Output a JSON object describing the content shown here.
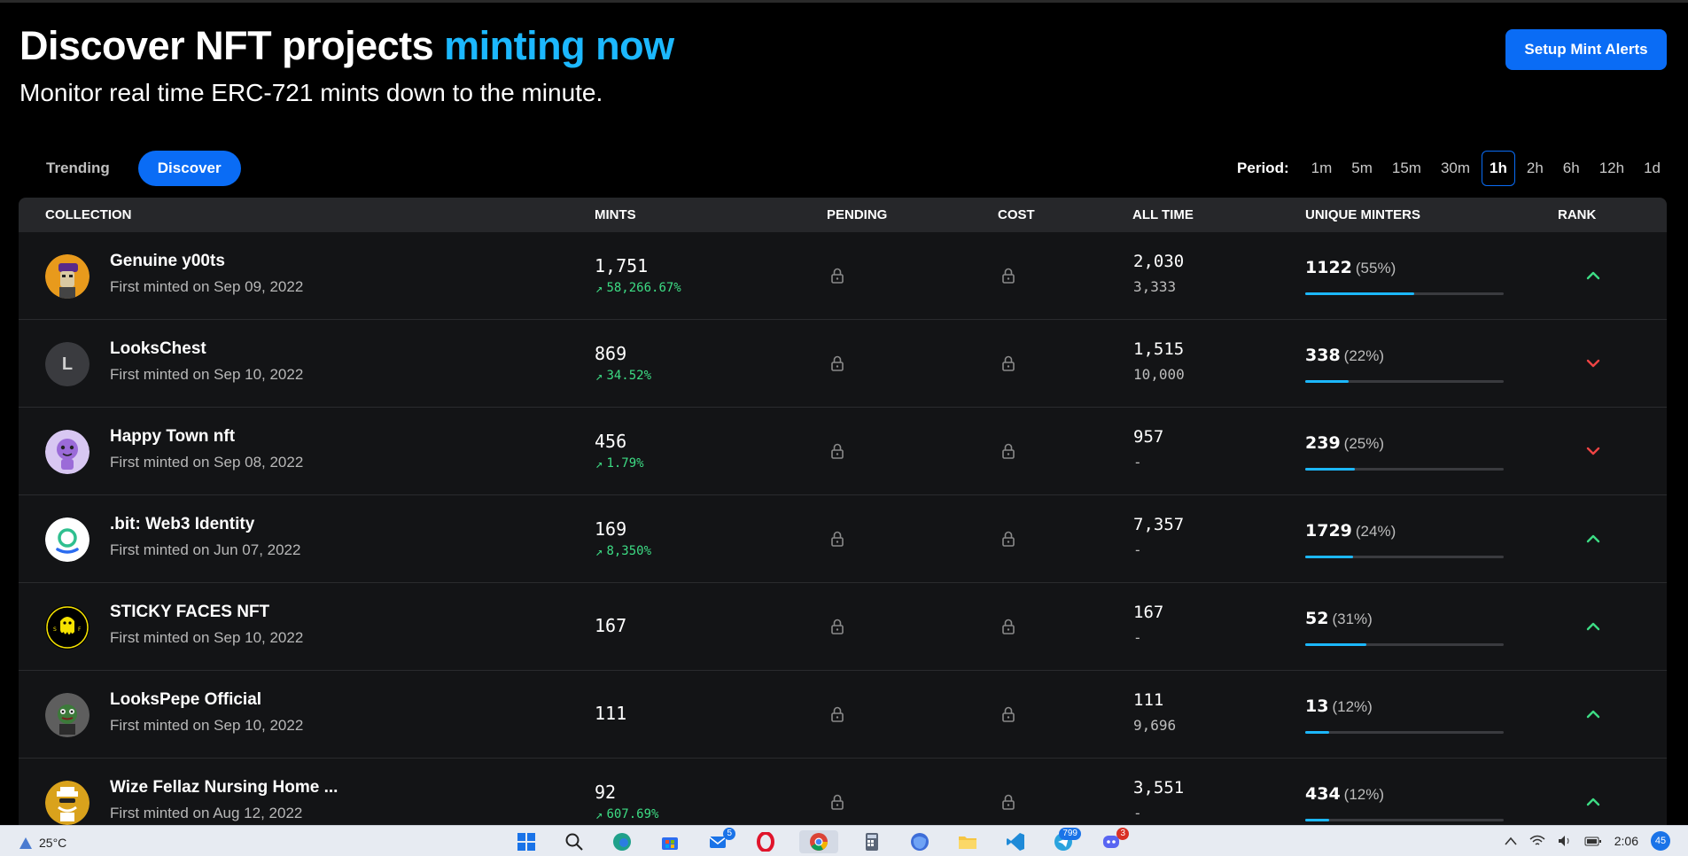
{
  "header": {
    "title_main": "Discover NFT projects",
    "title_accent": "minting now",
    "subtitle": "Monitor real time ERC-721 mints down to the minute.",
    "cta_label": "Setup Mint Alerts"
  },
  "tabs": [
    {
      "label": "Trending",
      "active": false
    },
    {
      "label": "Discover",
      "active": true
    }
  ],
  "period": {
    "label": "Period:",
    "options": [
      "1m",
      "5m",
      "15m",
      "30m",
      "1h",
      "2h",
      "6h",
      "12h",
      "1d"
    ],
    "selected": "1h"
  },
  "table": {
    "columns": [
      "COLLECTION",
      "MINTS",
      "PENDING",
      "COST",
      "ALL TIME",
      "UNIQUE MINTERS",
      "RANK"
    ],
    "rows": [
      {
        "name": "Genuine y00ts",
        "first_minted": "First minted on Sep 09, 2022",
        "mints": "1,751",
        "change": "58,266.67%",
        "all_time": "2,030",
        "supply": "3,333",
        "unique": "1122",
        "unique_pct": "(55%)",
        "unique_fraction": 0.55,
        "rank": "up",
        "avatar": "y00t-avatar-icon"
      },
      {
        "name": "LooksChest",
        "first_minted": "First minted on Sep 10, 2022",
        "mints": "869",
        "change": "34.52%",
        "all_time": "1,515",
        "supply": "10,000",
        "unique": "338",
        "unique_pct": "(22%)",
        "unique_fraction": 0.22,
        "rank": "down",
        "avatar": "L"
      },
      {
        "name": "Happy Town nft",
        "first_minted": "First minted on Sep 08, 2022",
        "mints": "456",
        "change": "1.79%",
        "all_time": "957",
        "supply": "-",
        "unique": "239",
        "unique_pct": "(25%)",
        "unique_fraction": 0.25,
        "rank": "down",
        "avatar": "happy-town-avatar-icon"
      },
      {
        "name": ".bit: Web3 Identity",
        "first_minted": "First minted on Jun 07, 2022",
        "mints": "169",
        "change": "8,350%",
        "all_time": "7,357",
        "supply": "-",
        "unique": "1729",
        "unique_pct": "(24%)",
        "unique_fraction": 0.24,
        "rank": "up",
        "avatar": "bit-logo-icon"
      },
      {
        "name": "STICKY FACES NFT",
        "first_minted": "First minted on Sep 10, 2022",
        "mints": "167",
        "change": "",
        "all_time": "167",
        "supply": "-",
        "unique": "52",
        "unique_pct": "(31%)",
        "unique_fraction": 0.31,
        "rank": "up",
        "avatar": "sticky-faces-avatar-icon"
      },
      {
        "name": "LooksPepe Official",
        "first_minted": "First minted on Sep 10, 2022",
        "mints": "111",
        "change": "",
        "all_time": "111",
        "supply": "9,696",
        "unique": "13",
        "unique_pct": "(12%)",
        "unique_fraction": 0.12,
        "rank": "up",
        "avatar": "pepe-avatar-icon"
      },
      {
        "name": "Wize Fellaz Nursing Home ...",
        "first_minted": "First minted on Aug 12, 2022",
        "mints": "92",
        "change": "607.69%",
        "all_time": "3,551",
        "supply": "-",
        "unique": "434",
        "unique_pct": "(12%)",
        "unique_fraction": 0.12,
        "rank": "up",
        "avatar": "wize-fellaz-avatar-icon"
      }
    ]
  },
  "taskbar": {
    "weather": "25°C",
    "apps": [
      {
        "name": "windows-start-icon",
        "badge": ""
      },
      {
        "name": "search-icon",
        "badge": ""
      },
      {
        "name": "edge-icon",
        "badge": ""
      },
      {
        "name": "store-icon",
        "badge": ""
      },
      {
        "name": "mail-icon",
        "badge": "5"
      },
      {
        "name": "opera-icon",
        "badge": ""
      },
      {
        "name": "chrome-icon",
        "badge": ""
      },
      {
        "name": "calculator-icon",
        "badge": ""
      },
      {
        "name": "firefox-icon",
        "badge": ""
      },
      {
        "name": "file-explorer-icon",
        "badge": ""
      },
      {
        "name": "vscode-icon",
        "badge": ""
      },
      {
        "name": "telegram-icon",
        "badge": "799"
      },
      {
        "name": "discord-icon",
        "badge": "3"
      }
    ],
    "clock": "2:06",
    "notifications": "45"
  },
  "colors": {
    "accent": "#1cb8ff",
    "primary_button": "#0a6cf5",
    "positive": "#3ddc84",
    "negative": "#ef4444"
  }
}
